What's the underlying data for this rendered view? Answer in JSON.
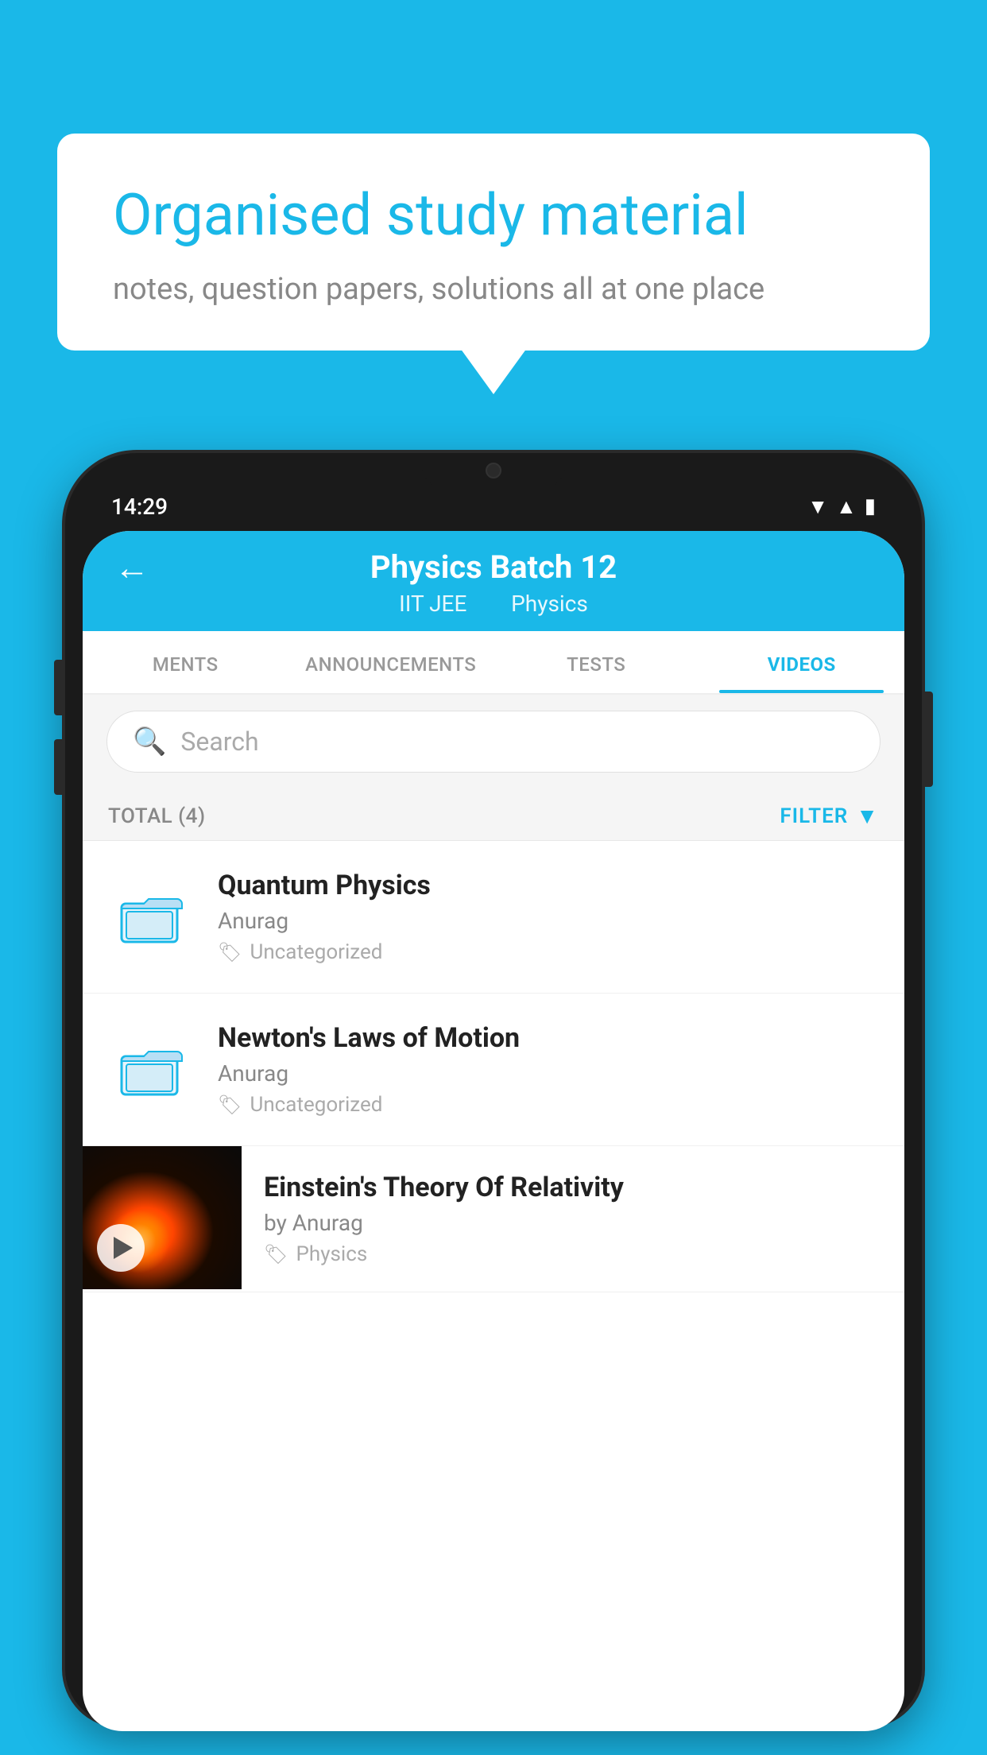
{
  "background_color": "#1ab8e8",
  "speech_bubble": {
    "title": "Organised study material",
    "subtitle": "notes, question papers, solutions all at one place"
  },
  "phone": {
    "status_bar": {
      "time": "14:29"
    },
    "header": {
      "title": "Physics Batch 12",
      "subtitle1": "IIT JEE",
      "subtitle2": "Physics",
      "back_label": "←"
    },
    "tabs": [
      {
        "label": "MENTS",
        "active": false
      },
      {
        "label": "ANNOUNCEMENTS",
        "active": false
      },
      {
        "label": "TESTS",
        "active": false
      },
      {
        "label": "VIDEOS",
        "active": true
      }
    ],
    "search": {
      "placeholder": "Search"
    },
    "filter_row": {
      "total_label": "TOTAL (4)",
      "filter_label": "FILTER"
    },
    "videos": [
      {
        "id": 1,
        "title": "Quantum Physics",
        "author": "Anurag",
        "tag": "Uncategorized",
        "has_thumb": false
      },
      {
        "id": 2,
        "title": "Newton's Laws of Motion",
        "author": "Anurag",
        "tag": "Uncategorized",
        "has_thumb": false
      },
      {
        "id": 3,
        "title": "Einstein's Theory Of Relativity",
        "author": "by Anurag",
        "tag": "Physics",
        "has_thumb": true
      }
    ]
  }
}
